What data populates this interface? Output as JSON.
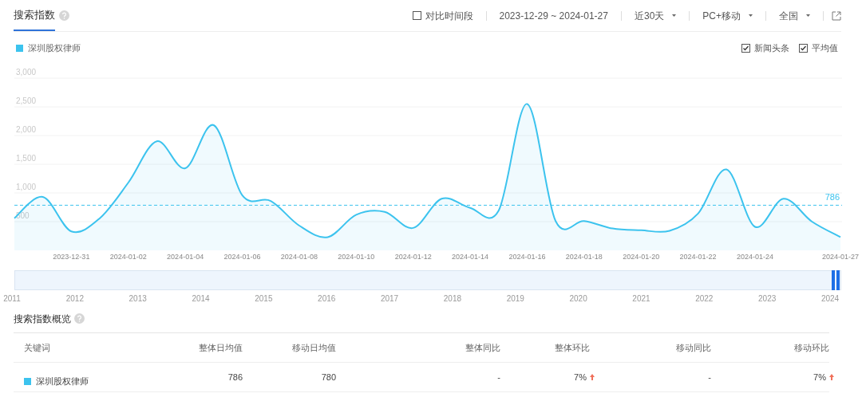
{
  "tabs": [
    {
      "label": "搜索指数",
      "selected": true
    }
  ],
  "toolbar": {
    "compare": {
      "label": "对比时间段",
      "checked": false
    },
    "date_range": "2023-12-29 ~ 2024-01-27",
    "dropdowns": [
      "近30天",
      "PC+移动",
      "全国"
    ]
  },
  "options": [
    {
      "label": "新闻头条",
      "checked": true
    },
    {
      "label": "平均值",
      "checked": true
    }
  ],
  "chart_data": {
    "type": "area",
    "grid": true,
    "categories": [
      null,
      null,
      "2023-12-31",
      null,
      "2024-01-02",
      null,
      "2024-01-04",
      null,
      "2024-01-06",
      null,
      "2024-01-08",
      null,
      "2024-01-10",
      null,
      "2024-01-12",
      null,
      "2024-01-14",
      null,
      "2024-01-16",
      null,
      "2024-01-18",
      null,
      "2024-01-20",
      null,
      "2024-01-22",
      null,
      "2024-01-24",
      null,
      null,
      "2024-01-27"
    ],
    "ylim": [
      0,
      3000
    ],
    "yticks": [
      {
        "value": 500,
        "label": "500"
      },
      {
        "value": 1000,
        "label": "1,000"
      },
      {
        "value": 1500,
        "label": "1,500"
      },
      {
        "value": 2000,
        "label": "2,000"
      },
      {
        "value": 2500,
        "label": "2,500"
      },
      {
        "value": 3000,
        "label": "3,000"
      }
    ],
    "series": [
      {
        "name": "深圳股权律师",
        "color": "#3cc3ee",
        "values": [
          560,
          930,
          330,
          560,
          1180,
          1900,
          1430,
          2180,
          960,
          860,
          430,
          230,
          620,
          670,
          390,
          900,
          740,
          690,
          2550,
          510,
          510,
          380,
          350,
          340,
          640,
          1410,
          410,
          900,
          500,
          230
        ]
      }
    ],
    "ref_lines": [
      {
        "axis": "y",
        "value": 786,
        "label": "786"
      }
    ]
  },
  "timeline": {
    "years": [
      "2011",
      "2012",
      "2013",
      "2014",
      "2015",
      "2016",
      "2017",
      "2018",
      "2019",
      "2020",
      "2021",
      "2022",
      "2023",
      "2024"
    ]
  },
  "overview": {
    "title": "搜索指数概览",
    "columns": [
      "关键词",
      "整体日均值",
      "移动日均值",
      "整体同比",
      "整体环比",
      "移动同比",
      "移动环比"
    ],
    "rows": [
      {
        "color": "#3cc3ee",
        "cells": [
          {
            "text": "深圳股权律师"
          },
          {
            "text": "786"
          },
          {
            "text": "780"
          },
          {
            "text": "-"
          },
          {
            "text": "7%",
            "rising": true
          },
          {
            "text": "-"
          },
          {
            "text": "7%",
            "rising": true
          }
        ]
      }
    ]
  }
}
